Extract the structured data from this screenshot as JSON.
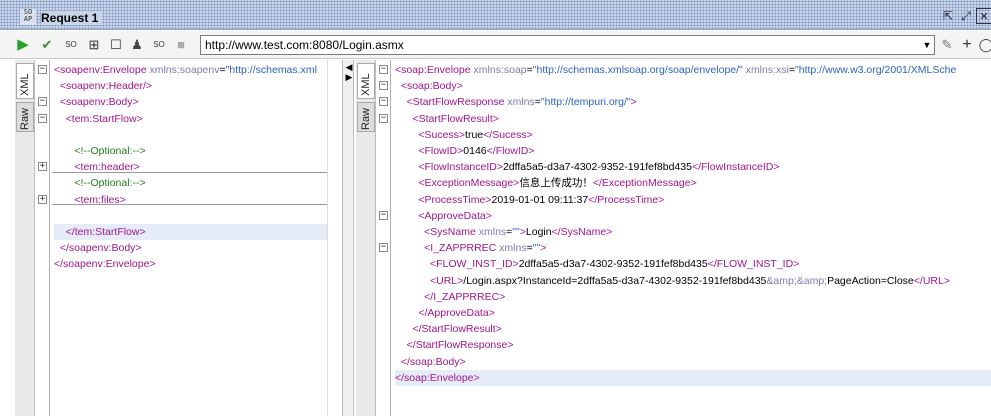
{
  "window": {
    "badge_text": "SO\nAP",
    "title": "Request 1"
  },
  "toolbar": {
    "url": "http://www.test.com:8080/Login.asmx"
  },
  "left_tabs": [
    "XML",
    "Raw"
  ],
  "right_tabs": [
    "XML",
    "Raw"
  ],
  "request_xml": [
    {
      "fold": "-",
      "parts": [
        [
          "tag",
          "<soapenv:Envelope "
        ],
        [
          "attr",
          "xmlns:soapenv"
        ],
        [
          "txt",
          "="
        ],
        [
          "val",
          "\"http://schemas.xml"
        ]
      ]
    },
    {
      "fold": "",
      "parts": [
        [
          "tag",
          "  <soapenv:Header/>"
        ]
      ]
    },
    {
      "fold": "-",
      "parts": [
        [
          "tag",
          "  <soapenv:Body>"
        ]
      ]
    },
    {
      "fold": "-",
      "parts": [
        [
          "tag",
          "    <tem:StartFlow>"
        ]
      ]
    },
    {
      "fold": "",
      "parts": []
    },
    {
      "fold": "",
      "parts": [
        [
          "com",
          "       <!--Optional:-->"
        ]
      ]
    },
    {
      "fold": "+",
      "parts": [
        [
          "tag",
          "       <tem:header>"
        ]
      ]
    },
    {
      "fold": "",
      "parts": [
        [
          "com",
          "       <!--Optional:-->"
        ]
      ]
    },
    {
      "fold": "+",
      "parts": [
        [
          "tag",
          "       <tem:files>"
        ]
      ]
    },
    {
      "fold": "",
      "parts": []
    },
    {
      "fold": "",
      "parts": [
        [
          "tag",
          "    </tem:StartFlow>"
        ]
      ],
      "hl": true
    },
    {
      "fold": "",
      "parts": [
        [
          "tag",
          "  </soapenv:Body>"
        ]
      ]
    },
    {
      "fold": "",
      "parts": [
        [
          "tag",
          "</soapenv:Envelope>"
        ]
      ]
    }
  ],
  "response_xml": [
    {
      "fold": "-",
      "parts": [
        [
          "tag",
          "<soap:Envelope "
        ],
        [
          "attr",
          "xmlns:soap"
        ],
        [
          "txt",
          "="
        ],
        [
          "val",
          "\"http://schemas.xmlsoap.org/soap/envelope/\" "
        ],
        [
          "attr",
          "xmlns:xsi"
        ],
        [
          "txt",
          "="
        ],
        [
          "val",
          "\"http://www.w3.org/2001/XMLSche"
        ]
      ]
    },
    {
      "fold": "-",
      "parts": [
        [
          "tag",
          "  <soap:Body>"
        ]
      ]
    },
    {
      "fold": "-",
      "parts": [
        [
          "tag",
          "    <StartFlowResponse "
        ],
        [
          "attr",
          "xmlns"
        ],
        [
          "txt",
          "="
        ],
        [
          "val",
          "\"http://tempuri.org/\""
        ],
        [
          "tag",
          ">"
        ]
      ]
    },
    {
      "fold": "-",
      "parts": [
        [
          "tag",
          "      <StartFlowResult>"
        ]
      ]
    },
    {
      "fold": "",
      "parts": [
        [
          "tag",
          "        <Sucess>"
        ],
        [
          "txt",
          "true"
        ],
        [
          "tag",
          "</Sucess>"
        ]
      ]
    },
    {
      "fold": "",
      "parts": [
        [
          "tag",
          "        <FlowID>"
        ],
        [
          "txt",
          "0146"
        ],
        [
          "tag",
          "</FlowID>"
        ]
      ]
    },
    {
      "fold": "",
      "parts": [
        [
          "tag",
          "        <FlowInstanceID>"
        ],
        [
          "txt",
          "2dffa5a5-d3a7-4302-9352-191fef8bd435"
        ],
        [
          "tag",
          "</FlowInstanceID>"
        ]
      ]
    },
    {
      "fold": "",
      "parts": [
        [
          "tag",
          "        <ExceptionMessage>"
        ],
        [
          "txt",
          "信息上传成功！"
        ],
        [
          "tag",
          "</ExceptionMessage>"
        ]
      ]
    },
    {
      "fold": "",
      "parts": [
        [
          "tag",
          "        <ProcessTime>"
        ],
        [
          "txt",
          "2019-01-01 09:11:37"
        ],
        [
          "tag",
          "</ProcessTime>"
        ]
      ]
    },
    {
      "fold": "-",
      "parts": [
        [
          "tag",
          "        <ApproveData>"
        ]
      ]
    },
    {
      "fold": "",
      "parts": [
        [
          "tag",
          "          <SysName "
        ],
        [
          "attr",
          "xmlns"
        ],
        [
          "txt",
          "="
        ],
        [
          "val",
          "\"\""
        ],
        [
          "tag",
          ">"
        ],
        [
          "txt",
          "Login"
        ],
        [
          "tag",
          "</SysName>"
        ]
      ]
    },
    {
      "fold": "-",
      "parts": [
        [
          "tag",
          "          <I_ZAPPRREC "
        ],
        [
          "attr",
          "xmlns"
        ],
        [
          "txt",
          "="
        ],
        [
          "val",
          "\"\""
        ],
        [
          "tag",
          ">"
        ]
      ]
    },
    {
      "fold": "",
      "parts": [
        [
          "tag",
          "            <FLOW_INST_ID>"
        ],
        [
          "txt",
          "2dffa5a5-d3a7-4302-9352-191fef8bd435"
        ],
        [
          "tag",
          "</FLOW_INST_ID>"
        ]
      ]
    },
    {
      "fold": "",
      "parts": [
        [
          "tag",
          "            <URL>"
        ],
        [
          "txt",
          "/Login.aspx?InstanceId=2dffa5a5-d3a7-4302-9352-191fef8bd435"
        ],
        [
          "attr",
          "&amp;&amp;"
        ],
        [
          "txt",
          "PageAction=Close"
        ],
        [
          "tag",
          "</URL>"
        ]
      ]
    },
    {
      "fold": "",
      "parts": [
        [
          "tag",
          "          </I_ZAPPRREC>"
        ]
      ]
    },
    {
      "fold": "",
      "parts": [
        [
          "tag",
          "        </ApproveData>"
        ]
      ]
    },
    {
      "fold": "",
      "parts": [
        [
          "tag",
          "      </StartFlowResult>"
        ]
      ]
    },
    {
      "fold": "",
      "parts": [
        [
          "tag",
          "    </StartFlowResponse>"
        ]
      ]
    },
    {
      "fold": "",
      "parts": [
        [
          "tag",
          "  </soap:Body>"
        ]
      ]
    },
    {
      "fold": "",
      "parts": [
        [
          "tag",
          "</soap:Envelope>"
        ]
      ],
      "hl": true
    }
  ]
}
